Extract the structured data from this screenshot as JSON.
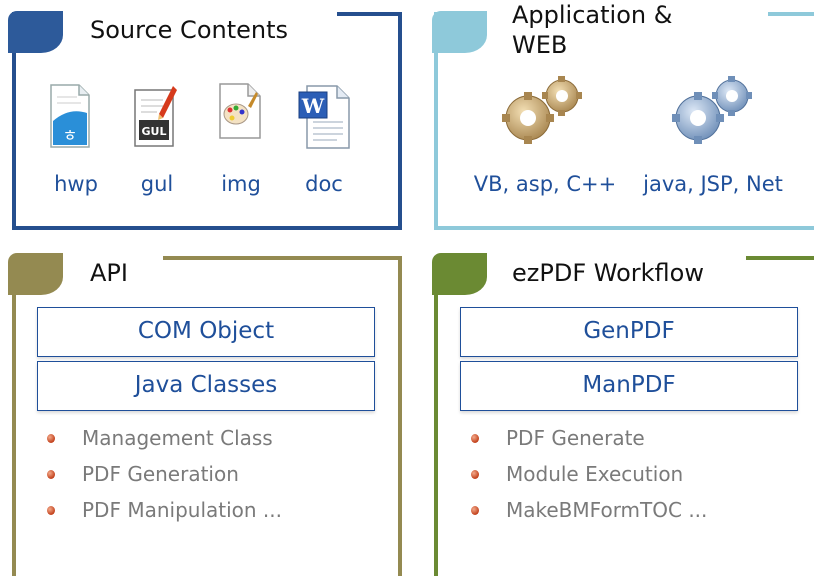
{
  "colors": {
    "source_contents": "#254f8e",
    "application_web": "#8ec9da",
    "api": "#948a51",
    "workflow": "#6b8a33",
    "link_text": "#1f4f9a",
    "list_text": "#7a7a7a"
  },
  "source_contents": {
    "title": "Source Contents",
    "files": [
      {
        "label": "hwp",
        "icon": "hwp-file-icon"
      },
      {
        "label": "gul",
        "icon": "gul-file-icon"
      },
      {
        "label": "img",
        "icon": "img-file-icon"
      },
      {
        "label": "doc",
        "icon": "doc-file-icon"
      }
    ]
  },
  "application_web": {
    "title_line1": "Application &",
    "title_line2": "WEB",
    "items": [
      {
        "label": "VB, asp, C++",
        "icon": "gears-icon"
      },
      {
        "label": "java, JSP, Net",
        "icon": "gears-icon"
      }
    ]
  },
  "api": {
    "title": "API",
    "boxes": [
      "COM Object",
      "Java Classes"
    ],
    "list": [
      "Management Class",
      "PDF Generation",
      "PDF Manipulation ..."
    ]
  },
  "workflow": {
    "title": "ezPDF Workflow",
    "boxes": [
      "GenPDF",
      "ManPDF"
    ],
    "list": [
      "PDF Generate",
      "Module Execution",
      "MakeBMFormTOC ..."
    ]
  }
}
